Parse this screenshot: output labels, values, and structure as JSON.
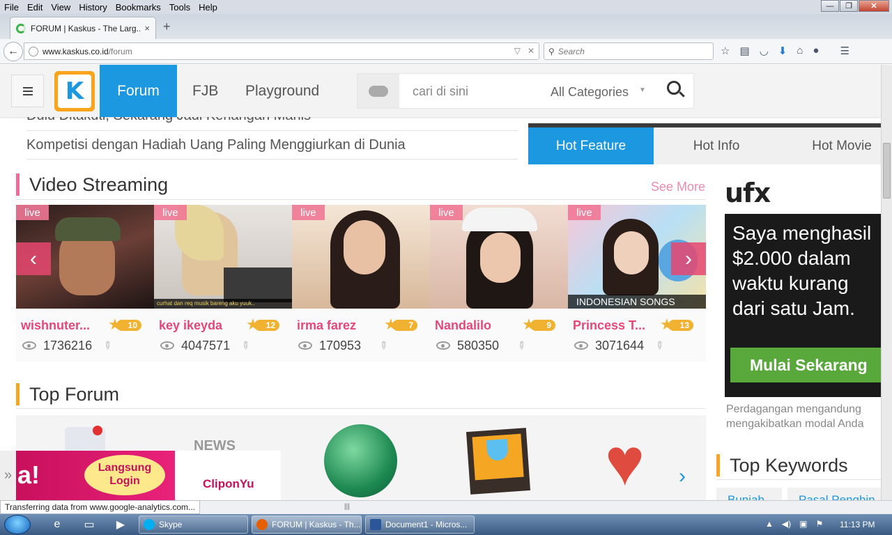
{
  "menubar": {
    "items": [
      "File",
      "Edit",
      "View",
      "History",
      "Bookmarks",
      "Tools",
      "Help"
    ]
  },
  "window_controls": {
    "minimize": "—",
    "maximize": "❐",
    "close": "✕"
  },
  "tab": {
    "title": "FORUM | Kaskus - The Larg...",
    "close": "×",
    "new_tab": "+"
  },
  "address": {
    "host": "www.kaskus.co.id",
    "path": "/forum",
    "full": "www.kaskus.co.id/forum"
  },
  "searchbox": {
    "placeholder": "Search"
  },
  "kaskus": {
    "logo": "K",
    "nav": {
      "forum": "Forum",
      "fjb": "FJB",
      "playground": "Playground"
    },
    "search": {
      "placeholder": "cari di sini",
      "category": "All Categories"
    }
  },
  "news": [
    "Dulu Ditakuti, Sekarang Jadi Kenangan Manis",
    "Kompetisi dengan Hadiah Uang Paling Menggiurkan di Dunia"
  ],
  "hot_tabs": [
    "Hot Feature",
    "Hot Info",
    "Hot Movie"
  ],
  "video_streaming": {
    "title": "Video Streaming",
    "see_more": "See More",
    "live_label": "live",
    "cards": [
      {
        "name": "wishnuter...",
        "level": "10",
        "views": "1736216",
        "caption": ""
      },
      {
        "name": "key ikeyda",
        "level": "12",
        "views": "4047571",
        "caption": "curhat dan req musik bareng aku yuuk.."
      },
      {
        "name": "irma farez",
        "level": "7",
        "views": "170953",
        "caption": ""
      },
      {
        "name": "Nandalilo",
        "level": "9",
        "views": "580350",
        "caption": ""
      },
      {
        "name": "Princess T...",
        "level": "13",
        "views": "3071644",
        "caption": "INDONESIAN SONGS"
      }
    ],
    "prev": "‹",
    "next": "›"
  },
  "top_forum": {
    "title": "Top Forum",
    "news_label": "NEWS",
    "next": "›"
  },
  "banner_ad": {
    "mark": "a!",
    "bubble": "Langsung Login",
    "brand": "CliponYu",
    "side": "»"
  },
  "ufx": {
    "logo": "ufx",
    "headline": "Saya menghasil $2.000 dalam waktu kurang dari satu Jam.",
    "cta": "Mulai Sekarang",
    "disclaimer_1": "Perdagangan mengandung",
    "disclaimer_2": "mengakibatkan modal Anda"
  },
  "top_keywords": {
    "title": "Top Keywords",
    "items": [
      "Bunjab",
      "Pasal Penghin"
    ]
  },
  "status": {
    "text": "Transferring data from www.google-analytics.com..."
  },
  "taskbar": {
    "tasks": [
      "Skype",
      "FORUM | Kaskus - Th...",
      "Document1 - Micros..."
    ],
    "clock": "11:13 PM"
  },
  "colors": {
    "kaskus_blue": "#1b98e0",
    "live_pink": "#e54878",
    "logo_orange": "#f8a51b",
    "ufx_green": "#58a83b"
  }
}
